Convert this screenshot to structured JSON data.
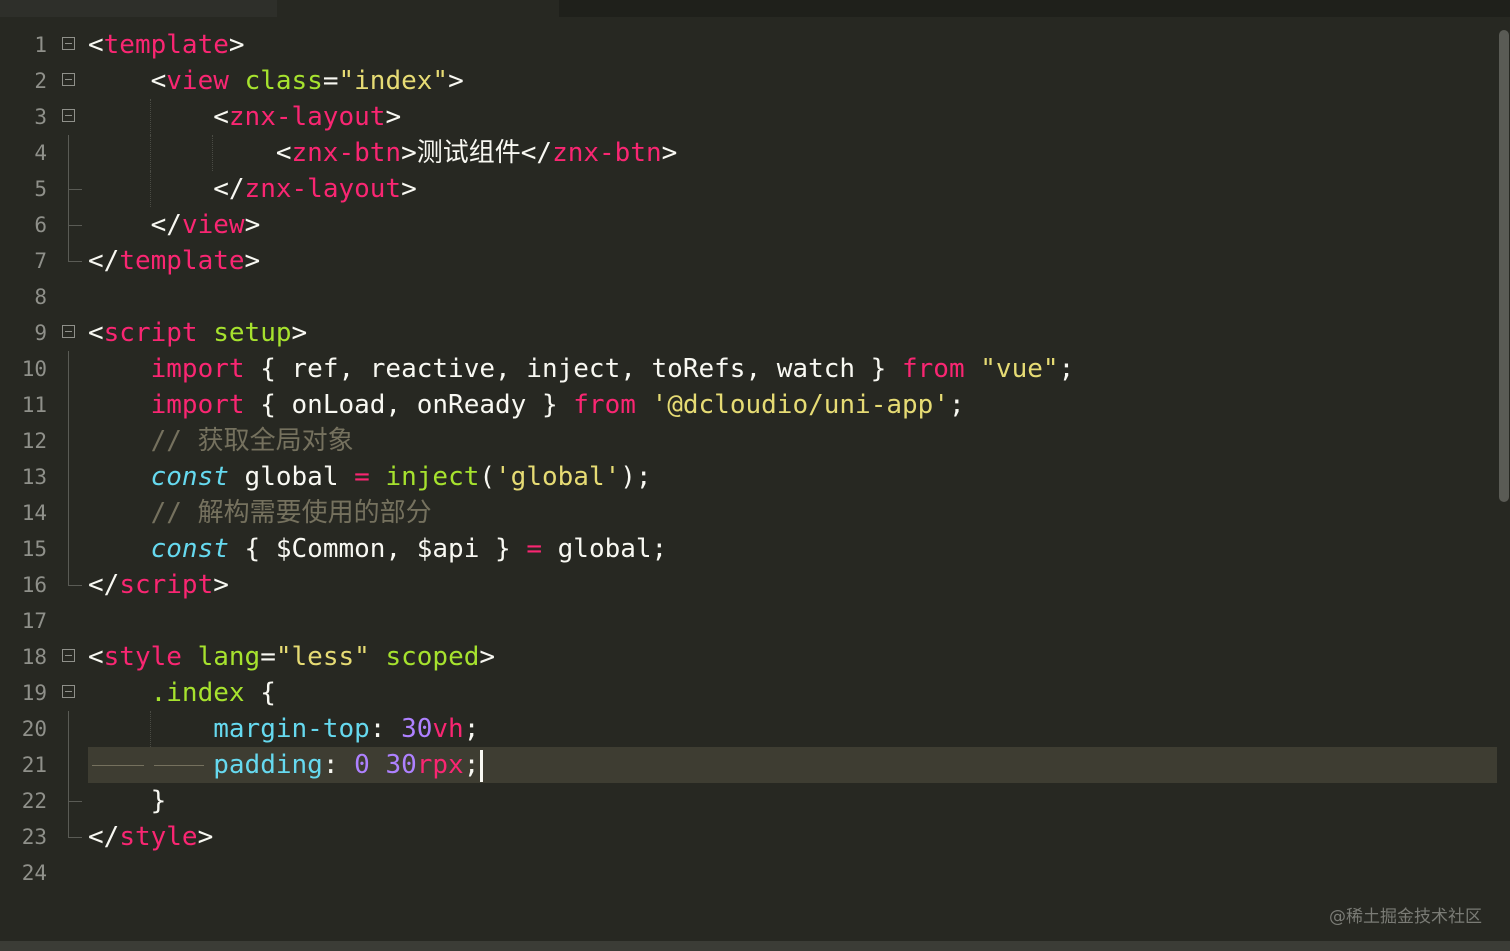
{
  "editor": {
    "line_numbers": [
      "1",
      "2",
      "3",
      "4",
      "5",
      "6",
      "7",
      "8",
      "9",
      "10",
      "11",
      "12",
      "13",
      "14",
      "15",
      "16",
      "17",
      "18",
      "19",
      "20",
      "21",
      "22",
      "23",
      "24"
    ],
    "lines": {
      "l1_open": "<",
      "l1_tag": "template",
      "l1_close": ">",
      "l2_ind": "    ",
      "l2_open": "<",
      "l2_tag": "view",
      "l2_sp": " ",
      "l2_attr": "class",
      "l2_eq": "=",
      "l2_val": "\"index\"",
      "l2_close": ">",
      "l3_ind": "        ",
      "l3_open": "<",
      "l3_tag": "znx-layout",
      "l3_close": ">",
      "l4_ind": "            ",
      "l4_open": "<",
      "l4_tag": "znx-btn",
      "l4_gt": ">",
      "l4_text": "测试组件",
      "l4_lt": "</",
      "l4_tag2": "znx-btn",
      "l4_close": ">",
      "l5_ind": "        ",
      "l5_open": "</",
      "l5_tag": "znx-layout",
      "l5_close": ">",
      "l6_ind": "    ",
      "l6_open": "</",
      "l6_tag": "view",
      "l6_close": ">",
      "l7_open": "</",
      "l7_tag": "template",
      "l7_close": ">",
      "l9_open": "<",
      "l9_tag": "script",
      "l9_sp": " ",
      "l9_attr": "setup",
      "l9_close": ">",
      "l10_ind": "    ",
      "l10_kw": "import",
      "l10_mid": " { ref, reactive, inject, toRefs, watch } ",
      "l10_from": "from",
      "l10_sp": " ",
      "l10_str": "\"vue\"",
      "l10_end": ";",
      "l11_ind": "    ",
      "l11_kw": "import",
      "l11_mid": " { onLoad, onReady } ",
      "l11_from": "from",
      "l11_sp": " ",
      "l11_str": "'@dcloudio/uni-app'",
      "l11_end": ";",
      "l12_ind": "    ",
      "l12_comment": "// 获取全局对象",
      "l13_ind": "    ",
      "l13_kw": "const",
      "l13_mid": " global ",
      "l13_op": "=",
      "l13_sp": " ",
      "l13_fn": "inject",
      "l13_p1": "(",
      "l13_str": "'global'",
      "l13_p2": ");",
      "l14_ind": "    ",
      "l14_comment": "// 解构需要使用的部分",
      "l15_ind": "    ",
      "l15_kw": "const",
      "l15_mid": " { $Common, $api } ",
      "l15_op": "=",
      "l15_end": " global;",
      "l16_open": "</",
      "l16_tag": "script",
      "l16_close": ">",
      "l18_open": "<",
      "l18_tag": "style",
      "l18_sp": " ",
      "l18_attr": "lang",
      "l18_eq": "=",
      "l18_val": "\"less\"",
      "l18_sp2": " ",
      "l18_attr2": "scoped",
      "l18_close": ">",
      "l19_ind": "    ",
      "l19_sel": ".index",
      "l19_end": " {",
      "l20_ind": "        ",
      "l20_prop": "margin-top",
      "l20_colon": ": ",
      "l20_num": "30",
      "l20_unit": "vh",
      "l20_end": ";",
      "l21_ind": "        ",
      "l21_prop": "padding",
      "l21_colon": ": ",
      "l21_num1": "0",
      "l21_sp": " ",
      "l21_num2": "30",
      "l21_unit": "rpx",
      "l21_end": ";",
      "l22_ind": "    ",
      "l22_brace": "}",
      "l23_open": "</",
      "l23_tag": "style",
      "l23_close": ">"
    }
  },
  "watermark": "@稀土掘金技术社区",
  "colors": {
    "background": "#272822",
    "tag": "#f92672",
    "attribute": "#a6e22e",
    "string": "#e6db74",
    "comment": "#75715e",
    "storage": "#66d9ef",
    "number": "#ae81ff"
  }
}
